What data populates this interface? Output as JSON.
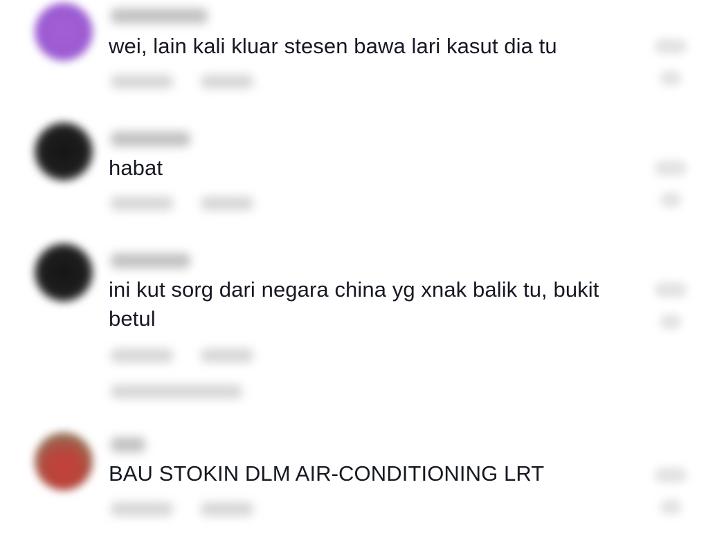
{
  "comments": [
    {
      "avatar_color": "#9b5bd2",
      "text": "wei, lain kali kluar stesen bawa lari kasut dia tu"
    },
    {
      "avatar_color": "#1e1e1e",
      "text": "habat"
    },
    {
      "avatar_color": "#1e1e1e",
      "text": "ini kut sorg dari negara china yg xnak balik tu, bukit betul"
    },
    {
      "avatar_color": "#c4403a",
      "text": "BAU STOKIN DLM AIR-CONDITIONING LRT"
    }
  ]
}
